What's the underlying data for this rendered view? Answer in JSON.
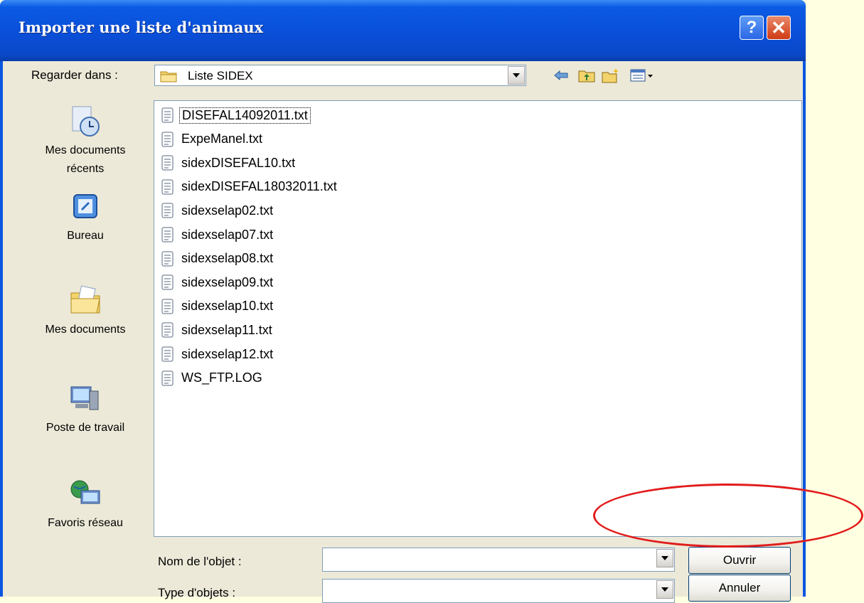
{
  "window": {
    "title": "Importer une liste d'animaux",
    "help_label": "?",
    "close_label": "✕"
  },
  "toolbar": {
    "lookin_label": "Regarder dans :",
    "lookin_value": "Liste SIDEX",
    "icons": [
      "back-arrow-icon",
      "up-folder-icon",
      "new-folder-icon",
      "view-menu-icon"
    ]
  },
  "places": [
    {
      "label": "Mes documents récents",
      "icon": "recent-documents-icon"
    },
    {
      "label": "Bureau",
      "icon": "desktop-icon"
    },
    {
      "label": "Mes documents",
      "icon": "my-documents-icon"
    },
    {
      "label": "Poste de travail",
      "icon": "my-computer-icon"
    },
    {
      "label": "Favoris réseau",
      "icon": "network-places-icon"
    }
  ],
  "files": [
    "DISEFAL14092011.txt",
    "ExpeManel.txt",
    "sidexDISEFAL10.txt",
    "sidexDISEFAL18032011.txt",
    "sidexselap02.txt",
    "sidexselap07.txt",
    "sidexselap08.txt",
    "sidexselap09.txt",
    "sidexselap10.txt",
    "sidexselap11.txt",
    "sidexselap12.txt",
    "WS_FTP.LOG"
  ],
  "footer": {
    "filename_label": "Nom de l'objet :",
    "filename_value": "",
    "filetype_label": "Type d'objets :",
    "filetype_value": "",
    "open_label": "Ouvrir",
    "cancel_label": "Annuler"
  },
  "colors": {
    "titlebar": "#0a4fd8",
    "dialog_bg": "#ece9d8",
    "annotation": "#e21b1b",
    "page_bg": "#ffffe1"
  }
}
